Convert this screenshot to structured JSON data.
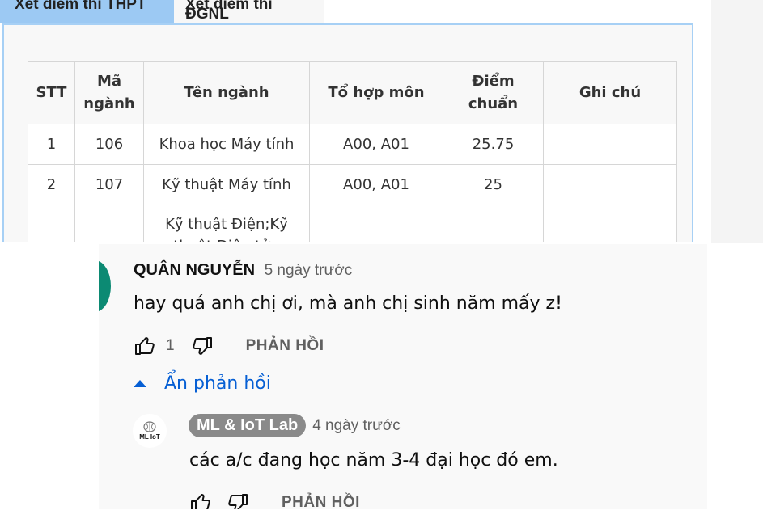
{
  "tabs": [
    {
      "label": "Xét điểm thi THPT",
      "active": true
    },
    {
      "label": "Xét điểm thi ĐGNL",
      "active": false
    }
  ],
  "table": {
    "headers": [
      "STT",
      "Mã ngành",
      "Tên ngành",
      "Tổ hợp môn",
      "Điểm chuẩn",
      "Ghi chú"
    ],
    "rows": [
      {
        "stt": "1",
        "code": "106",
        "name": "Khoa học Máy tính",
        "combo": "A00, A01",
        "score": "25.75",
        "note": ""
      },
      {
        "stt": "2",
        "code": "107",
        "name": "Kỹ thuật Máy tính",
        "combo": "A00, A01",
        "score": "25",
        "note": ""
      },
      {
        "stt": "",
        "code": "",
        "name": "Kỹ thuật Điện;Kỹ thuật Điện tử - Viễn",
        "combo": "",
        "score": "",
        "note": ""
      }
    ]
  },
  "comments": {
    "main": {
      "author": "QUÂN NGUYỄN",
      "time": "5 ngày trước",
      "text": "hay quá anh chị ơi, mà anh chị sinh năm mấy z!",
      "likes": "1",
      "reply_label": "PHẢN HỒI"
    },
    "toggle_label": "Ẩn phản hồi",
    "reply": {
      "author": "ML & IoT Lab",
      "avatar_text": "ML IoT",
      "time": "4 ngày trước",
      "text": "các a/c đang học năm 3-4 đại học đó em.",
      "reply_label": "PHẢN HỒI"
    },
    "colors": {
      "link": "#065fd4",
      "avatar": "#0c8a73",
      "chip": "#8a8a8a"
    }
  }
}
